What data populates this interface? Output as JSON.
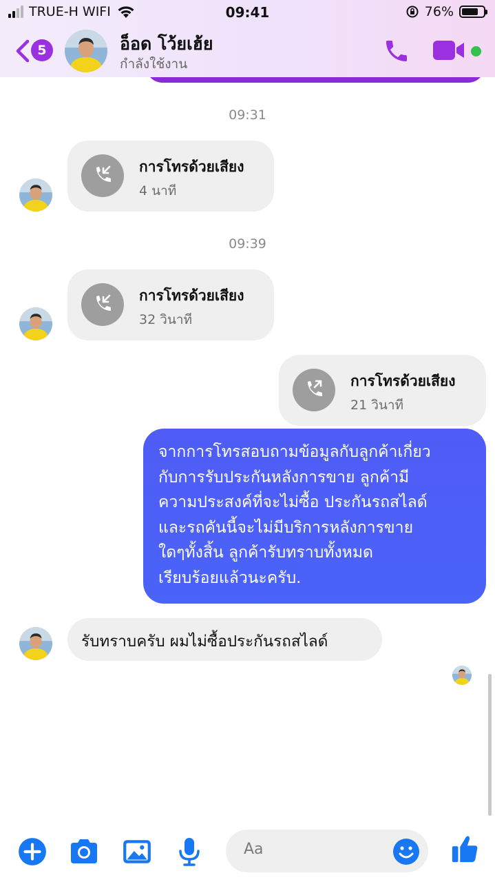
{
  "status_bar": {
    "carrier": "TRUE-H WIFI",
    "time": "09:41",
    "battery": "76%",
    "battery_level": 0.76
  },
  "header": {
    "unread_count": "5",
    "contact_name": "อ็อด โว้ยเฮ้ย",
    "contact_status": "กำลังใช้งาน"
  },
  "colors": {
    "accent": "#9b30e0",
    "outgoing_bubble": "#4a5ff7",
    "incoming_bubble": "#efefef",
    "online": "#31c24d",
    "composer_icon": "#1877f2"
  },
  "messages": {
    "ts1": "09:31",
    "call1": {
      "title": "การโทรด้วยเสียง",
      "duration": "4 นาที"
    },
    "ts2": "09:39",
    "call2": {
      "title": "การโทรด้วยเสียง",
      "duration": "32 วินาที"
    },
    "call3": {
      "title": "การโทรด้วยเสียง",
      "duration": "21 วินาที"
    },
    "outgoing_lines": [
      "จากการโทรสอบถามข้อมูลกับลูกค้าเกี่ยว",
      "กับการรับประกันหลังการขาย ลูกค้ามี",
      "ความประสงค์ที่จะไม่ซื้อ ประกันรถสไลด์",
      "และรถคันนี้จะไม่มีบริการหลังการขาย",
      "ใดๆทั้งสิ้น ลูกค้ารับทราบทั้งหมด",
      "เรียบร้อยแล้วนะครับ."
    ],
    "incoming_text": "รับทราบครับ ผมไม่ซื้อประกันรถสไลด์"
  },
  "composer": {
    "placeholder": "Aa"
  },
  "icons": {
    "header": [
      "back-chevron-icon",
      "phone-icon",
      "video-camera-icon"
    ],
    "call": [
      "incoming-call-icon",
      "outgoing-call-icon"
    ],
    "composer": [
      "plus-icon",
      "camera-icon",
      "image-icon",
      "microphone-icon",
      "emoji-icon",
      "thumbs-up-icon"
    ]
  }
}
